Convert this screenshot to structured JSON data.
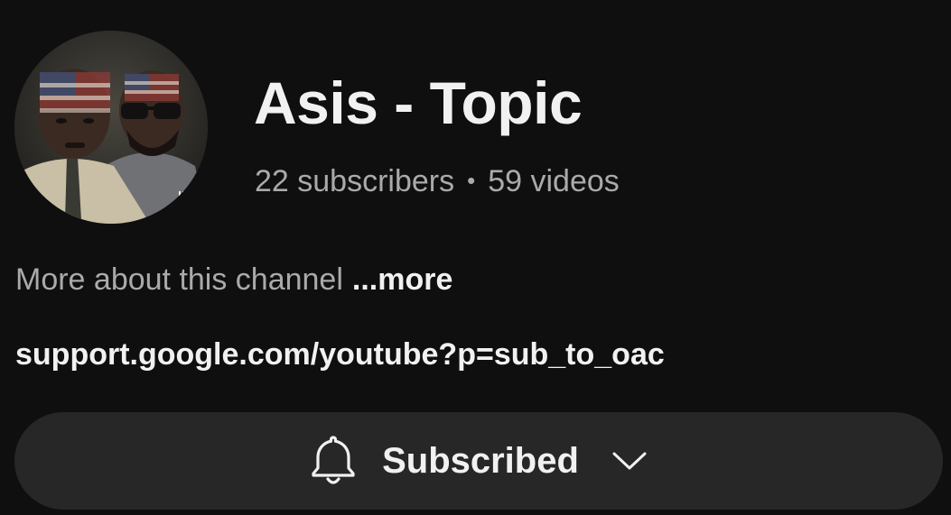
{
  "channel": {
    "name": "Asis - Topic",
    "subscribers": "22 subscribers",
    "separator": "•",
    "videos": "59 videos"
  },
  "about": {
    "text": "More about this channel",
    "more_label": "...more"
  },
  "link": {
    "text": "support.google.com/youtube?p=sub_to_oac"
  },
  "subscribe": {
    "label": "Subscribed",
    "icon": "bell-icon",
    "dropdown_icon": "chevron-down-icon"
  },
  "colors": {
    "background": "#0f0f0f",
    "button": "#272727",
    "text_primary": "#f1f1f1",
    "text_secondary": "#aaaaaa"
  }
}
